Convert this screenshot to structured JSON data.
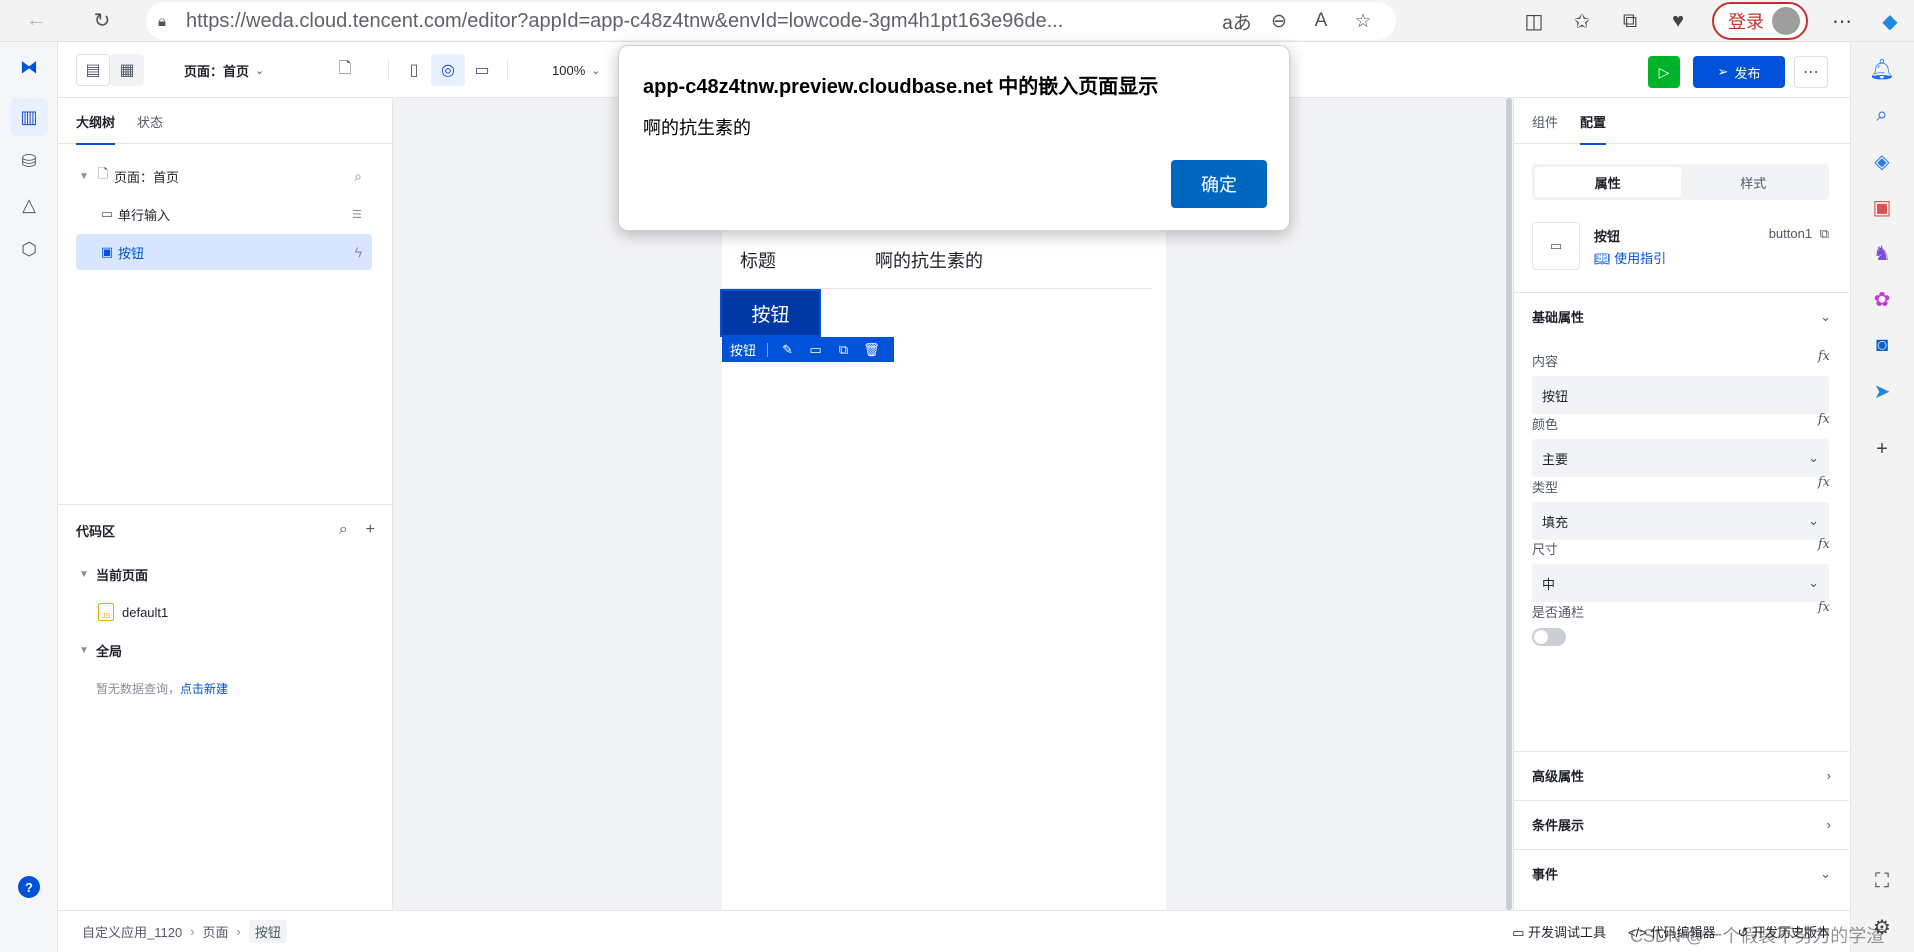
{
  "browser": {
    "url": "https://weda.cloud.tencent.com/editor?appId=app-c48z4tnw&envId=lowcode-3gm4h1pt163e96de...",
    "login_label": "登录"
  },
  "toolbar": {
    "page_select": "页面：首页",
    "zoom": "100%",
    "publish_label": "发布"
  },
  "left_panel": {
    "tabs": [
      "大纲树",
      "状态"
    ],
    "tree": {
      "page": "页面：首页",
      "input": "单行输入",
      "button": "按钮"
    },
    "code": {
      "title": "代码区",
      "current_page": "当前页面",
      "file": "default1",
      "global": "全局",
      "empty_text": "暂无数据查询，",
      "empty_link": "点击新建",
      "js_badge": "JS"
    }
  },
  "canvas": {
    "form_label": "标题",
    "form_value": "啊的抗生素的",
    "button_label": "按钮",
    "selection_label": "按钮"
  },
  "dialog": {
    "title": "app-c48z4tnw.preview.cloudbase.net 中的嵌入页面显示",
    "message": "啊的抗生素的",
    "ok_label": "确定"
  },
  "right_panel": {
    "tabs": [
      "组件",
      "配置"
    ],
    "segments": [
      "属性",
      "样式"
    ],
    "component": {
      "name": "按钮",
      "guide": "使用指引",
      "id": "button1"
    },
    "basic_section": "基础属性",
    "props": {
      "content_label": "内容",
      "content_value": "按钮",
      "color_label": "颜色",
      "color_value": "主要",
      "type_label": "类型",
      "type_value": "填充",
      "size_label": "尺寸",
      "size_value": "中",
      "block_label": "是否通栏"
    },
    "fx": "fx",
    "advanced_section": "高级属性",
    "condition_section": "条件展示",
    "events_section": "事件"
  },
  "status_bar": {
    "breadcrumb": [
      "自定义应用_1120",
      "页面",
      "按钮"
    ],
    "tools": [
      "开发调试工具",
      "代码编辑器",
      "开发历史版本"
    ]
  },
  "watermark": "CSDN @一个假装不努力的学渣",
  "colors": {
    "primary": "#0052d9",
    "canvas_button": "#0039a6",
    "dialog_button": "#0067c0",
    "run": "#00b42a"
  }
}
